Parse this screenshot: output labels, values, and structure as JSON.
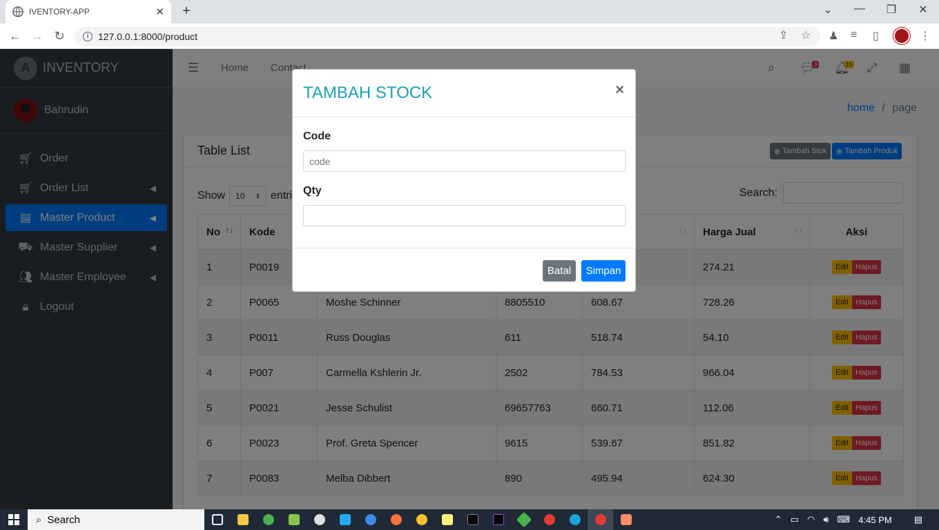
{
  "browser": {
    "tab_title": "IVENTORY-APP",
    "url": "127.0.0.1:8000/product"
  },
  "sidebar": {
    "brand": "INVENTORY",
    "user": "Bahrudin",
    "items": [
      {
        "label": "Order",
        "icon": "cart-icon"
      },
      {
        "label": "Order List",
        "icon": "cart-icon"
      },
      {
        "label": "Master Product",
        "icon": "book-icon"
      },
      {
        "label": "Master Supplier",
        "icon": "truck-icon"
      },
      {
        "label": "Master Employee",
        "icon": "users-icon"
      },
      {
        "label": "Logout",
        "icon": "lock-icon"
      }
    ]
  },
  "topnav": {
    "home": "Home",
    "contact": "Contact",
    "messages_count": "3",
    "notifications_count": "15"
  },
  "breadcrumb": {
    "home": "home",
    "sep": "/",
    "current": "page"
  },
  "card": {
    "title": "Table List",
    "tambah_stok": "Tambah Stok",
    "tambah_produk": "Tambah Produk",
    "show": "Show",
    "length_value": "10",
    "entries": "entries",
    "search_label": "Search:"
  },
  "table": {
    "headers": [
      "No",
      "Kode",
      "",
      "",
      "li",
      "Harga Jual",
      "Aksi"
    ],
    "rows": [
      {
        "no": "1",
        "kode": "P0019",
        "nama": "",
        "stok": "",
        "beli": "",
        "jual": "274.21"
      },
      {
        "no": "2",
        "kode": "P0065",
        "nama": "Moshe Schinner",
        "stok": "8805510",
        "beli": "608.67",
        "jual": "728.26"
      },
      {
        "no": "3",
        "kode": "P0011",
        "nama": "Russ Douglas",
        "stok": "611",
        "beli": "518.74",
        "jual": "54.10"
      },
      {
        "no": "4",
        "kode": "P007",
        "nama": "Carmella Kshlerin Jr.",
        "stok": "2502",
        "beli": "784.53",
        "jual": "966.04"
      },
      {
        "no": "5",
        "kode": "P0021",
        "nama": "Jesse Schulist",
        "stok": "69657763",
        "beli": "660.71",
        "jual": "112.06"
      },
      {
        "no": "6",
        "kode": "P0023",
        "nama": "Prof. Greta Spencer",
        "stok": "9615",
        "beli": "539.67",
        "jual": "851.82"
      },
      {
        "no": "7",
        "kode": "P0083",
        "nama": "Melba Dibbert",
        "stok": "890",
        "beli": "495.94",
        "jual": "624.30"
      }
    ],
    "edit": "Edit",
    "hapus": "Hapus"
  },
  "modal": {
    "title": "TAMBAH STOCK",
    "close": "×",
    "code_label": "Code",
    "code_placeholder": "code",
    "qty_label": "Qty",
    "batal": "Batal",
    "simpan": "Simpan"
  },
  "taskbar": {
    "search": "Search",
    "time": "4:45 PM"
  },
  "colors": {
    "primary": "#007bff",
    "sidebar_bg": "#343a40",
    "modal_title": "#17a2b8",
    "edit": "#ffc107",
    "hapus": "#dc3545",
    "batal": "#6c757d"
  }
}
